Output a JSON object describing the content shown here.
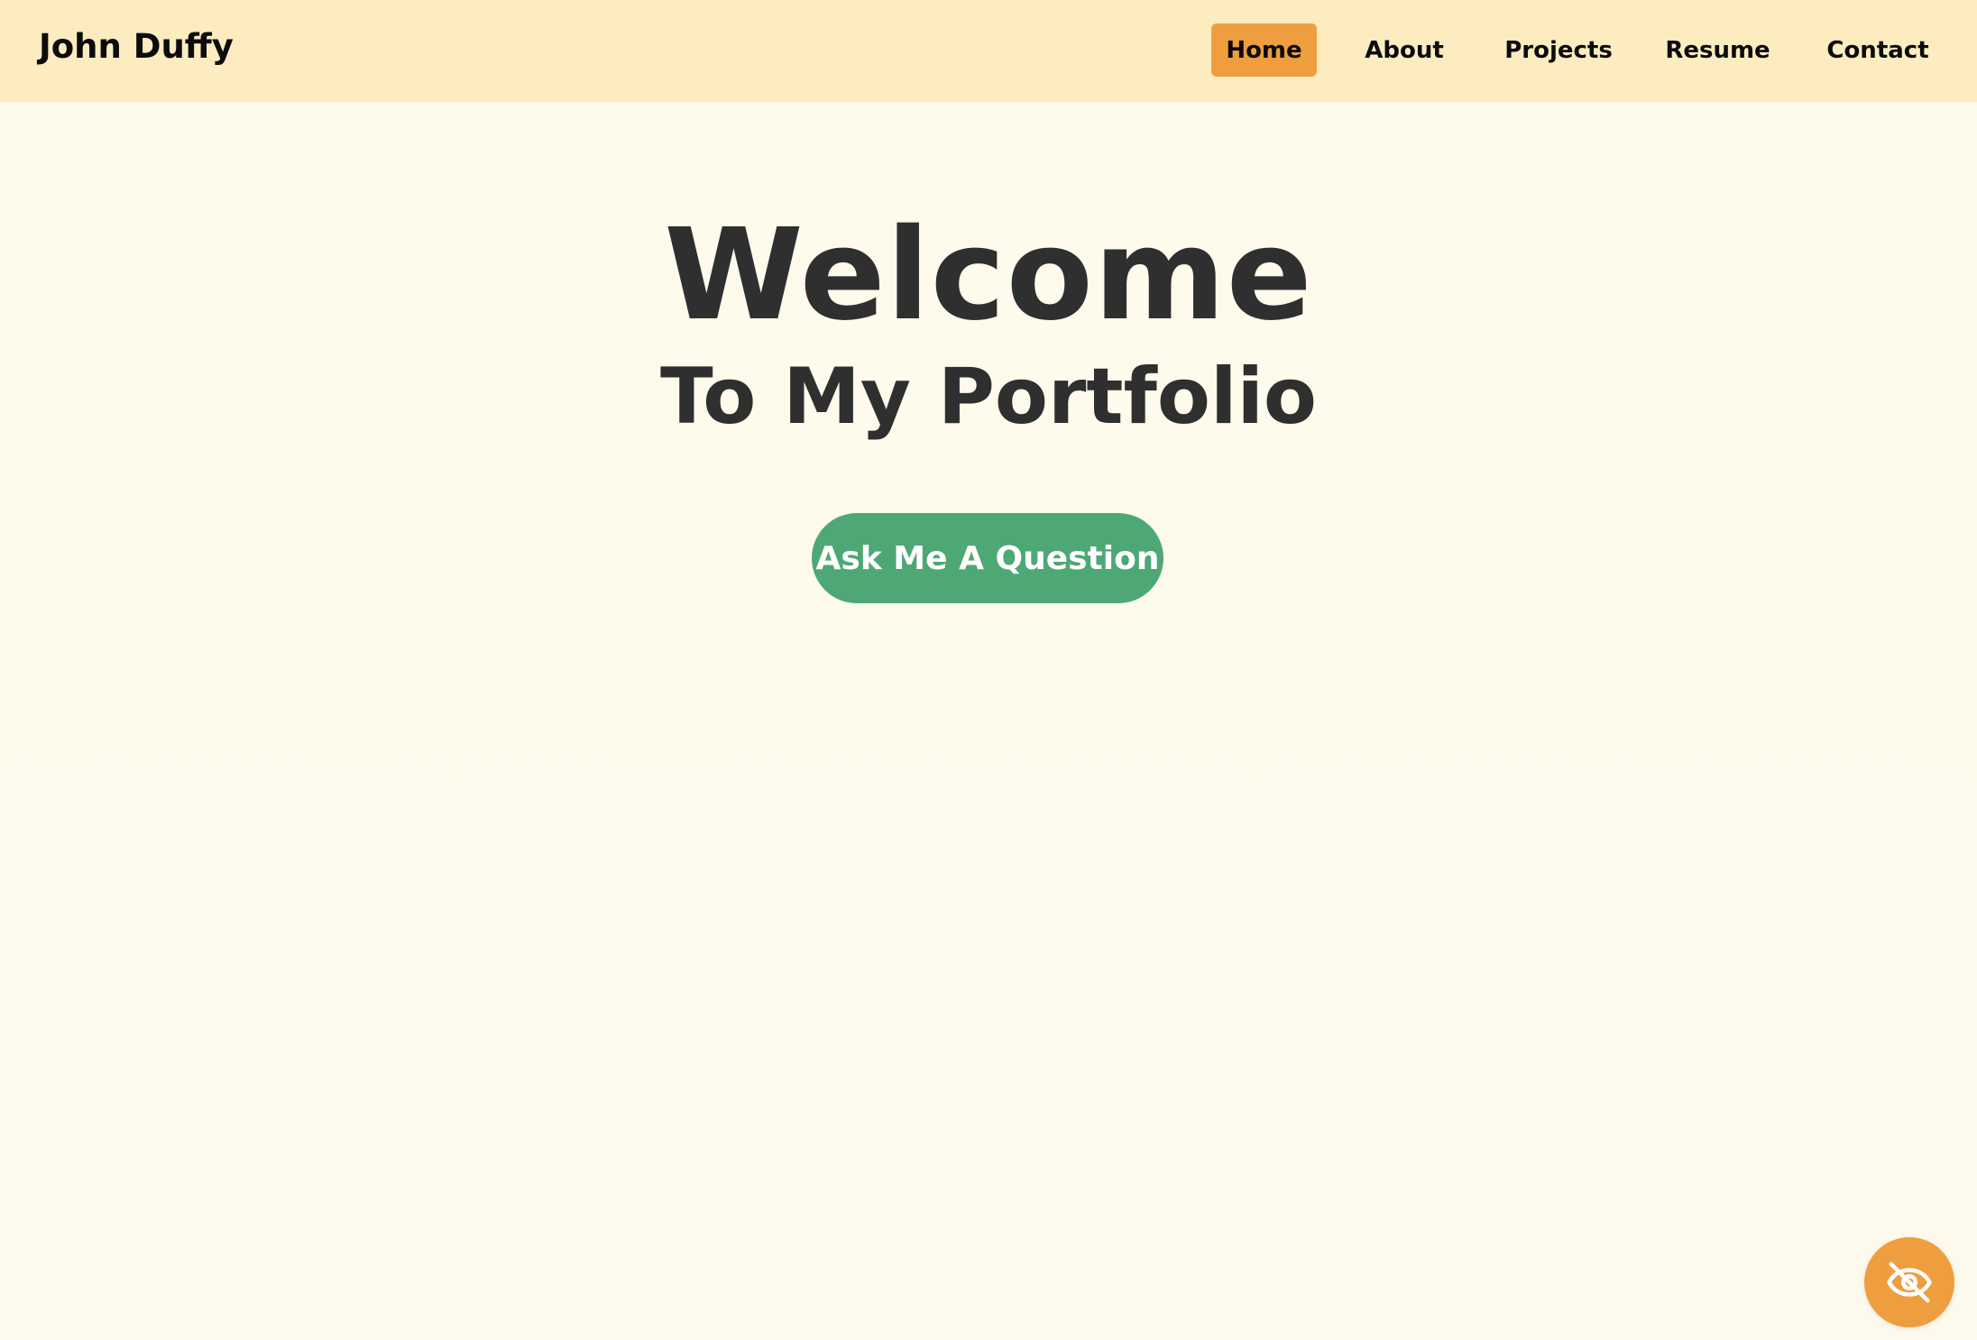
{
  "header": {
    "brand": "John Duffy",
    "nav": [
      {
        "label": "Home",
        "active": true
      },
      {
        "label": "About",
        "active": false
      },
      {
        "label": "Projects",
        "active": false
      },
      {
        "label": "Resume",
        "active": false
      },
      {
        "label": "Contact",
        "active": false
      }
    ]
  },
  "hero": {
    "title": "Welcome",
    "subtitle": "To My Portfolio",
    "cta_label": "Ask Me A Question"
  },
  "floating_button": {
    "icon": "eye-off-icon"
  },
  "colors": {
    "header_bg": "#fcecc0",
    "page_bg": "#fefaec",
    "accent_orange": "#ee9e3e",
    "cta_green": "#4ea875",
    "text_dark": "#2f2f2f"
  }
}
